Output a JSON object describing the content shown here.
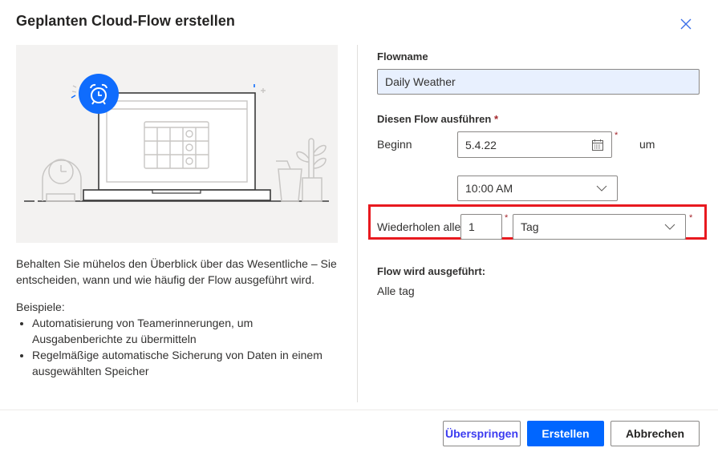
{
  "dialog": {
    "title": "Geplanten Cloud-Flow erstellen",
    "close_icon": "close-icon"
  },
  "illustration": {
    "description": "laptop-with-calendar-and-alarm-clock",
    "accent_color": "#0f6cfd"
  },
  "description": {
    "intro": "Behalten Sie mühelos den Überblick über das Wesentliche – Sie entscheiden, wann und wie häufig der Flow ausgeführt wird.",
    "examples_label": "Beispiele:",
    "examples": [
      "Automatisierung von Teamerinnerungen, um Ausgabenberichte zu übermitteln",
      "Regelmäßige automatische Sicherung von Daten in einem ausgewählten Speicher"
    ]
  },
  "form": {
    "flowname_label": "Flowname",
    "flowname_value": "Daily Weather",
    "run_label": "Diesen Flow ausführen",
    "required_mark": "*",
    "start_label": "Beginn",
    "start_date": "5.4.22",
    "at_label": "um",
    "start_time": "10:00 AM",
    "repeat_label": "Wiederholen alle",
    "repeat_interval": "1",
    "repeat_unit": "Tag",
    "summary_label": "Flow wird ausgeführt:",
    "summary_value": "Alle tag"
  },
  "footer": {
    "skip_label": "Überspringen",
    "create_label": "Erstellen",
    "cancel_label": "Abbrechen"
  },
  "colors": {
    "primary": "#0066ff",
    "highlight_border": "#e8191f",
    "required": "#a4262c",
    "flowname_bg": "#e8f0fe"
  }
}
